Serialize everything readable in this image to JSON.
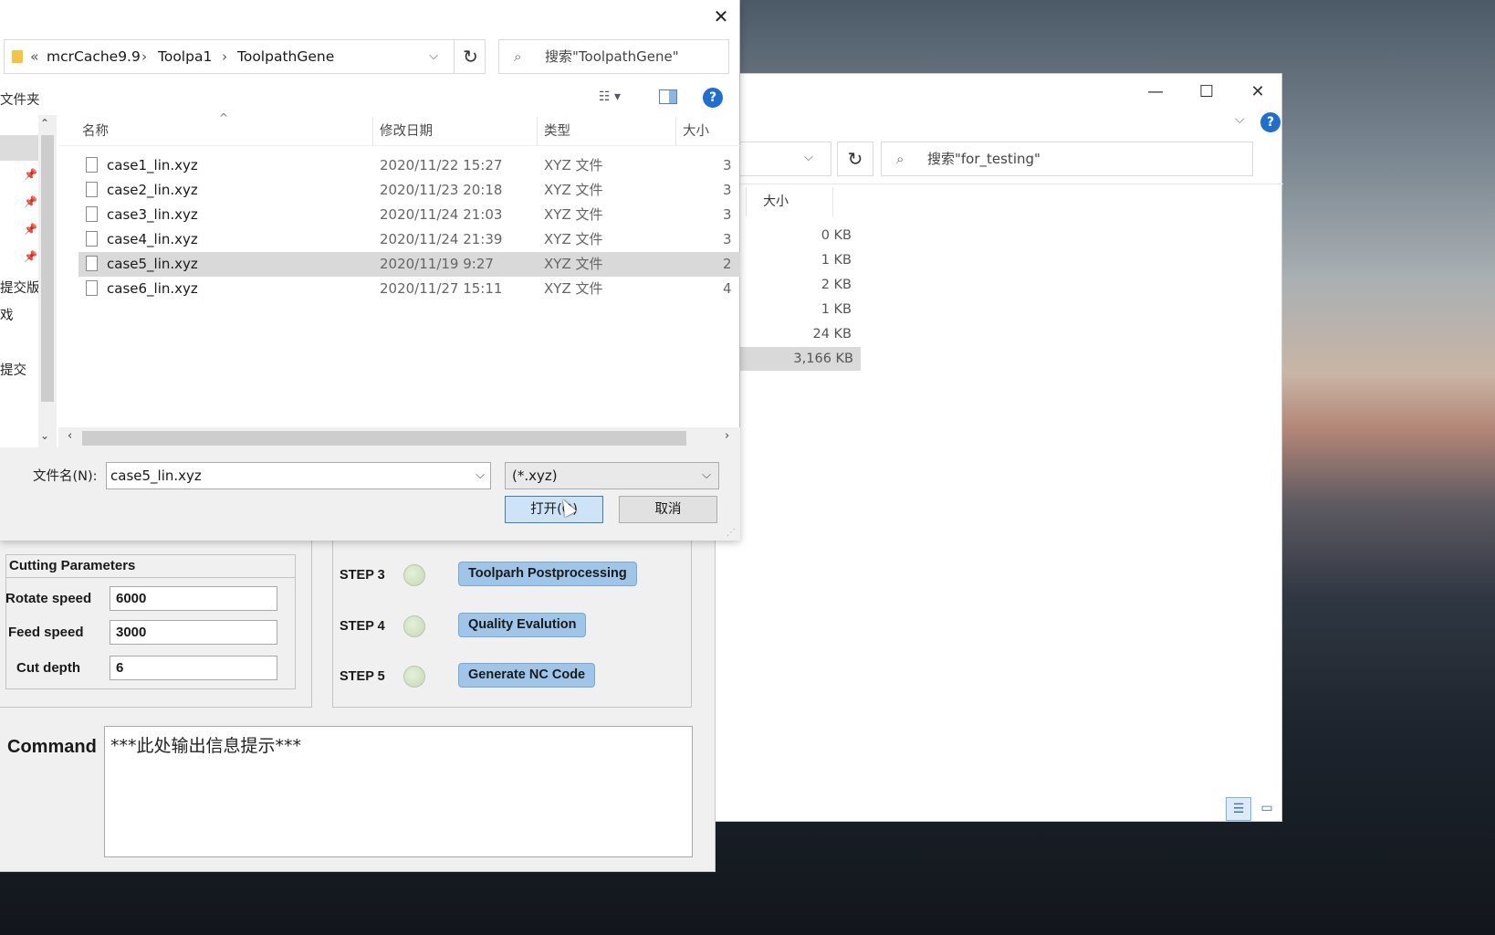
{
  "colors": {
    "accent": "#1f6fd1",
    "selected_row": "#d9d9d9",
    "step_button": "#9fc6e8",
    "led": "#c5d8b4"
  },
  "explorer": {
    "minimize_icon": "—",
    "maximize_icon": "☐",
    "close_icon": "✕",
    "chevron_icon": "⌵",
    "help_label": "?",
    "refresh_icon": "↻",
    "search_icon": "⌕",
    "search_placeholder": "搜索\"for_testing\"",
    "column_size": "大小",
    "sizes": [
      "0 KB",
      "1 KB",
      "2 KB",
      "1 KB",
      "24 KB",
      "3,166 KB"
    ],
    "path_dropdown_icon": "⌵",
    "view_details_icon": "☰",
    "view_tiles_icon": "▭"
  },
  "app": {
    "panel_title": "Cutting Parameters",
    "params": [
      {
        "label": "Rotate speed",
        "value": "6000"
      },
      {
        "label": "Feed speed",
        "value": "3000"
      },
      {
        "label": "Cut depth",
        "value": "6"
      }
    ],
    "steps": [
      {
        "label": "STEP 3",
        "button": "Toolparh Postprocessing"
      },
      {
        "label": "STEP 4",
        "button": "Quality Evalution"
      },
      {
        "label": "STEP 5",
        "button": "Generate NC Code"
      }
    ],
    "command_label": "Command",
    "command_text": "***此处输出信息提示***"
  },
  "dialog": {
    "close_icon": "✕",
    "breadcrumb": {
      "prefix": "«",
      "items": [
        "mcrCache9.9",
        "Toolpa1",
        "ToolpathGene"
      ],
      "sep": "›"
    },
    "path_dropdown_icon": "⌵",
    "refresh_icon": "↻",
    "search_icon": "⌕",
    "search_placeholder": "搜索\"ToolpathGene\"",
    "toolbar_left": "文件夹",
    "view_menu_icon": "☷ ▾",
    "help_label": "?",
    "nav": {
      "items": [
        "提交版",
        "戏",
        "提交"
      ],
      "pin_icon": "📌",
      "up_icon": "⌃",
      "down_icon": "⌄"
    },
    "sort_caret": "^",
    "columns": {
      "name": "名称",
      "date": "修改日期",
      "type": "类型",
      "size": "大小"
    },
    "files": [
      {
        "name": "case1_lin.xyz",
        "date": "2020/11/22 15:27",
        "type": "XYZ 文件",
        "size": "3"
      },
      {
        "name": "case2_lin.xyz",
        "date": "2020/11/23 20:18",
        "type": "XYZ 文件",
        "size": "3"
      },
      {
        "name": "case3_lin.xyz",
        "date": "2020/11/24 21:03",
        "type": "XYZ 文件",
        "size": "3"
      },
      {
        "name": "case4_lin.xyz",
        "date": "2020/11/24 21:39",
        "type": "XYZ 文件",
        "size": "3"
      },
      {
        "name": "case5_lin.xyz",
        "date": "2020/11/19 9:27",
        "type": "XYZ 文件",
        "size": "2"
      },
      {
        "name": "case6_lin.xyz",
        "date": "2020/11/27 15:11",
        "type": "XYZ 文件",
        "size": "4"
      }
    ],
    "hscroll": {
      "left_icon": "‹",
      "right_icon": "›"
    },
    "filename_label": "文件名(N):",
    "filename_value": "case5_lin.xyz",
    "filename_dropdown_icon": "⌵",
    "filetype_value": "(*.xyz)",
    "filetype_dropdown_icon": "⌵",
    "open_label": "打开(O)",
    "cancel_label": "取消",
    "grip_icon": "⋰"
  }
}
